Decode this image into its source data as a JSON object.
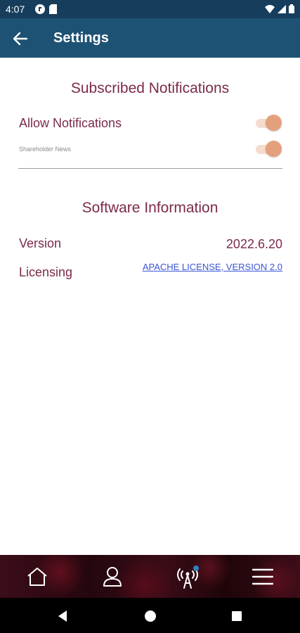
{
  "status_bar": {
    "time": "4:07"
  },
  "app_bar": {
    "title": "Settings"
  },
  "notifications": {
    "heading": "Subscribed Notifications",
    "allow_label": "Allow Notifications",
    "allow_on": true,
    "shareholder_label": "Shareholder News",
    "shareholder_on": true
  },
  "software": {
    "heading": "Software Information",
    "version_label": "Version",
    "version_value": "2022.6.20",
    "licensing_label": "Licensing",
    "license_link": "APACHE LICENSE, VERSION 2.0"
  },
  "bottom_nav": {
    "items": [
      "home-icon",
      "profile-icon",
      "broadcast-icon",
      "menu-icon"
    ]
  },
  "colors": {
    "app_bar": "#1e5274",
    "status_bar": "#163e5c",
    "accent_text": "#7b2a4c",
    "toggle_thumb": "#e4a07c",
    "toggle_track": "#f6dccd",
    "link": "#3a55d6"
  }
}
